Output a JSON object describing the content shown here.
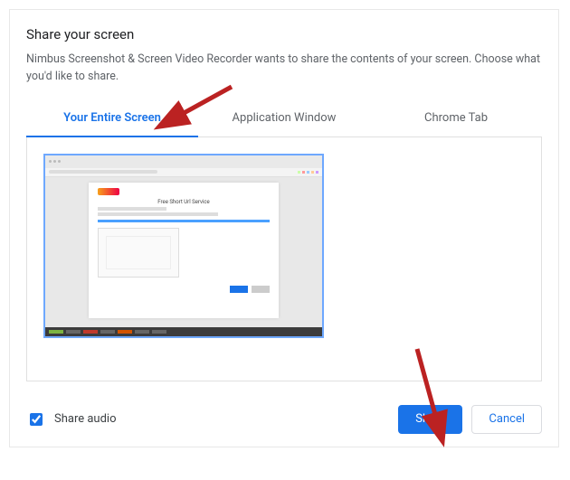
{
  "dialog": {
    "title": "Share your screen",
    "subtitle": "Nimbus Screenshot & Screen Video Recorder wants to share the contents of your screen. Choose what you'd like to share."
  },
  "tabs": {
    "entire_screen": "Your Entire Screen",
    "app_window": "Application Window",
    "chrome_tab": "Chrome Tab"
  },
  "preview": {
    "page_title": "Free Short Url Service"
  },
  "footer": {
    "share_audio": "Share audio",
    "share": "Share",
    "cancel": "Cancel"
  }
}
